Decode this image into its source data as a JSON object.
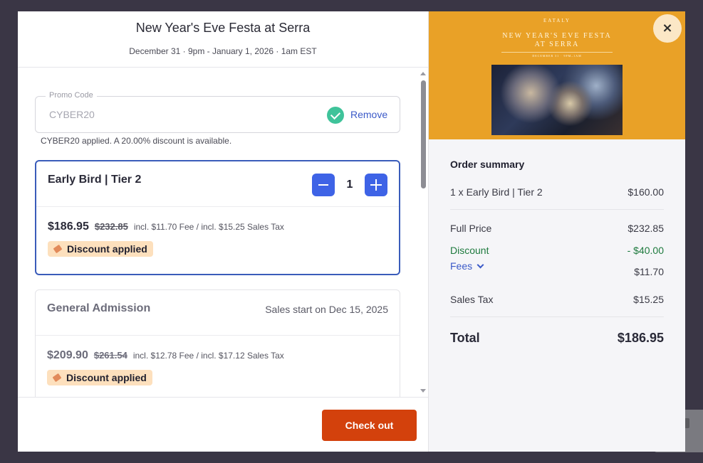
{
  "event": {
    "title": "New Year's Eve Festa at Serra",
    "dates": "December 31 · 9pm - January 1, 2026 · 1am EST"
  },
  "promo": {
    "legend": "Promo Code",
    "value": "CYBER20",
    "remove_label": "Remove",
    "note": "CYBER20 applied. A 20.00% discount is available."
  },
  "tickets": [
    {
      "name": "Early Bird | Tier 2",
      "quantity": "1",
      "price": "$186.95",
      "old_price": "$232.85",
      "incl": "incl. $11.70 Fee / incl. $15.25 Sales Tax",
      "badge": "Discount applied"
    },
    {
      "name": "General Admission",
      "sales_start": "Sales start on Dec 15, 2025",
      "price": "$209.90",
      "old_price": "$261.54",
      "incl": "incl. $12.78 Fee / incl. $17.12 Sales Tax",
      "badge": "Discount applied"
    }
  ],
  "checkout_label": "Check out",
  "banner": {
    "brand": "EATALY",
    "title_line1": "NEW YEAR'S EVE FESTA",
    "title_line2": "AT SERRA",
    "date": "DECEMBER 31 · 9PM–1AM"
  },
  "close_label": "×",
  "summary": {
    "heading": "Order summary",
    "item_label": "1 x Early Bird | Tier 2",
    "item_value": "$160.00",
    "full_price_label": "Full Price",
    "full_price_value": "$232.85",
    "discount_label": "Discount",
    "discount_value": "- $40.00",
    "fees_label": "Fees",
    "fees_value": "$11.70",
    "tax_label": "Sales Tax",
    "tax_value": "$15.25",
    "total_label": "Total",
    "total_value": "$186.95"
  },
  "colors": {
    "accent": "#3e63e6",
    "checkout": "#d3410c",
    "banner": "#e9a127",
    "discount_text": "#1e7a3e",
    "badge_bg": "#fde0bd"
  },
  "icons": [
    "check-circle-icon",
    "minus-icon",
    "plus-icon",
    "tag-icon",
    "chevron-down-icon",
    "close-icon"
  ]
}
